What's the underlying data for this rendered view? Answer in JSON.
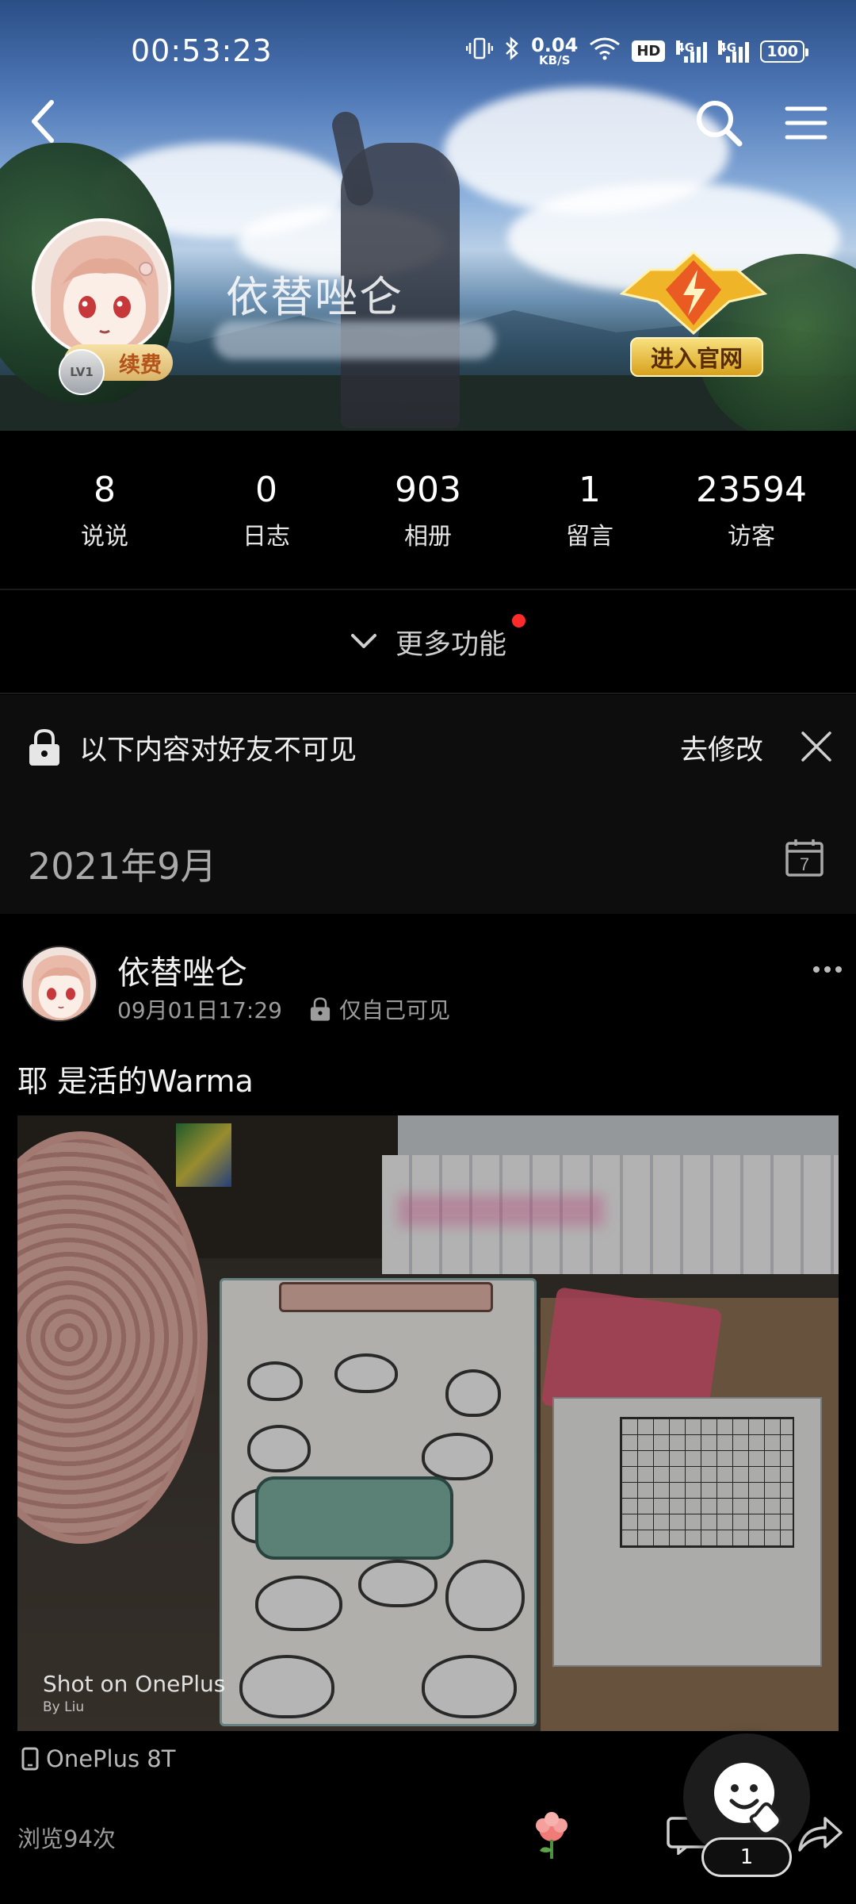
{
  "status_bar": {
    "time": "00:53:23",
    "net_speed_value": "0.04",
    "net_speed_unit": "KB/S",
    "hd_badge": "HD",
    "signal1_label": "4G",
    "signal2_label": "4G",
    "battery": "100"
  },
  "profile": {
    "name": "依替唑仑",
    "level": "LV1",
    "renew_label": "续费",
    "official_label": "进入官网"
  },
  "stats": [
    {
      "value": "8",
      "label": "说说"
    },
    {
      "value": "0",
      "label": "日志"
    },
    {
      "value": "903",
      "label": "相册"
    },
    {
      "value": "1",
      "label": "留言"
    },
    {
      "value": "23594",
      "label": "访客"
    }
  ],
  "more_functions": {
    "label": "更多功能"
  },
  "notice": {
    "text": "以下内容对好友不可见",
    "edit_label": "去修改"
  },
  "month": {
    "label": "2021年9月",
    "calendar_day": "7"
  },
  "post": {
    "author": "依替唑仑",
    "time": "09月01日17:29",
    "visibility": "仅自己可见",
    "text": "耶 是活的Warma",
    "photo_watermark": "Shot on OnePlus",
    "photo_watermark_sub": "By Liu",
    "device": "OnePlus 8T",
    "views": "浏览94次"
  },
  "fab": {
    "count": "1"
  },
  "colors": {
    "background": "#000000",
    "notice_bg": "#0d0d0d",
    "red_dot": "#ff2b2b",
    "renew_text": "#b4531a",
    "official_bg": "#d8a11c"
  }
}
